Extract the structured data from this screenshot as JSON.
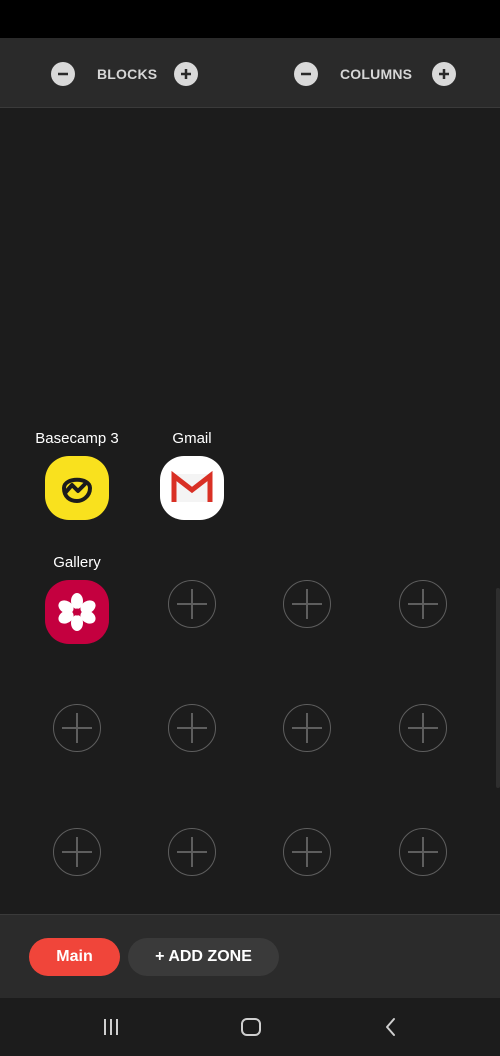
{
  "top_bar": {
    "blocks_label": "BLOCKS",
    "columns_label": "COLUMNS"
  },
  "apps": [
    {
      "label": "Basecamp 3",
      "icon": "basecamp-icon",
      "color": "#f9e11e"
    },
    {
      "label": "Gmail",
      "icon": "gmail-icon",
      "color": "#ffffff"
    },
    {
      "label": "Gallery",
      "icon": "gallery-icon",
      "color": "#c4003f"
    }
  ],
  "bottom_bar": {
    "main_zone": "Main",
    "add_zone": "+ ADD ZONE"
  },
  "nav": {
    "recents": "recents-icon",
    "home": "home-icon",
    "back": "back-icon"
  },
  "colors": {
    "accent": "#f0453a",
    "background": "#1c1c1c"
  }
}
